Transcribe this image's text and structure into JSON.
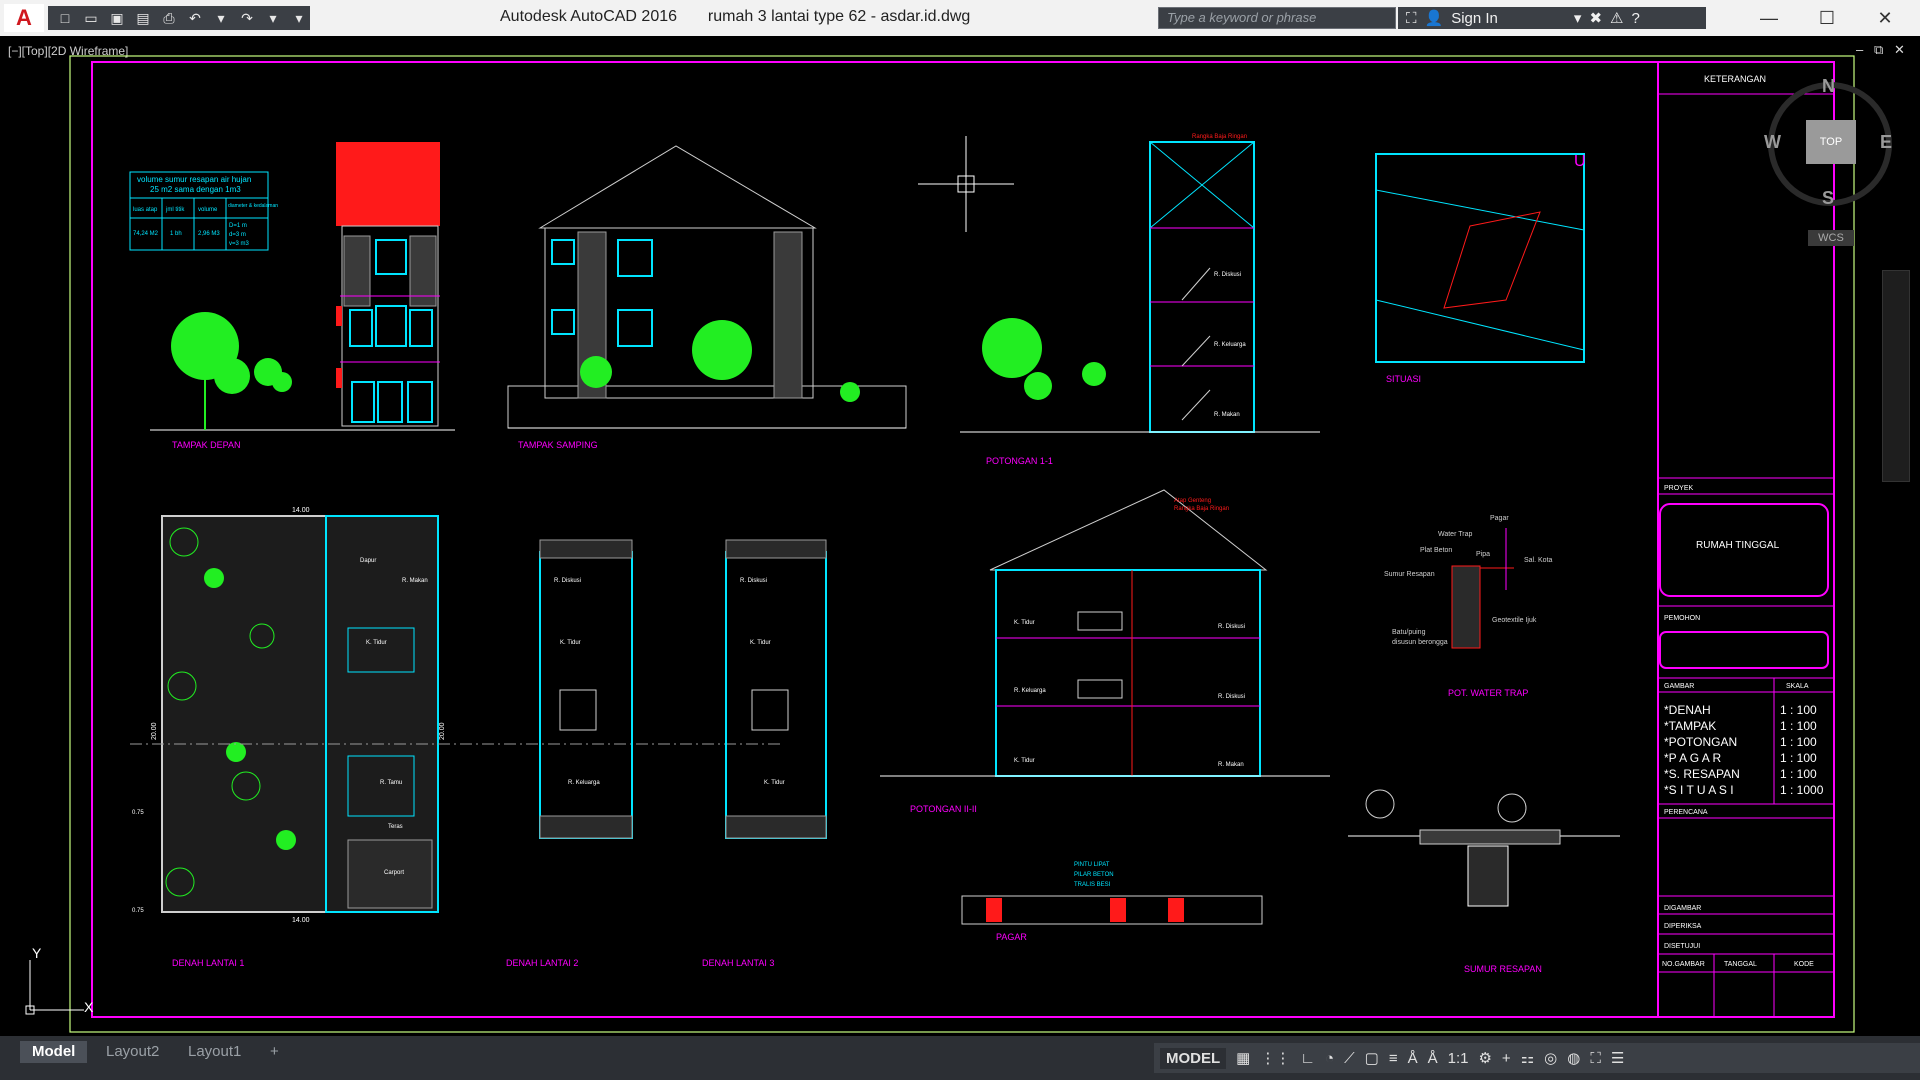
{
  "app": {
    "title": "Autodesk AutoCAD 2016",
    "file": "rumah 3 lantai type 62 - asdar.id.dwg"
  },
  "search": {
    "placeholder": "Type a keyword or phrase"
  },
  "user": {
    "sign_in": "Sign In"
  },
  "viewport": {
    "label": "[−][Top][2D Wireframe]"
  },
  "navcube": {
    "n": "N",
    "s": "S",
    "e": "E",
    "w": "W",
    "top": "TOP",
    "wcs": "WCS"
  },
  "ucs": {
    "y": "Y",
    "x": "X"
  },
  "drawing": {
    "titles": {
      "tampak_depan": "TAMPAK DEPAN",
      "tampak_samping": "TAMPAK SAMPING",
      "potongan_1": "POTONGAN 1-1",
      "situasi": "SITUASI",
      "denah1": "DENAH LANTAI 1",
      "denah2": "DENAH LANTAI 2",
      "denah3": "DENAH LANTAI 3",
      "potongan_2": "POTONGAN II-II",
      "pagar": "PAGAR",
      "water_trap": "POT. WATER TRAP",
      "sumur": "SUMUR RESAPAN"
    },
    "table": {
      "title1": "volume sumur resapan air hujan",
      "title2": "25 m2 sama dengan 1m3",
      "h1": "luas atap",
      "h2": "jml titik",
      "h3": "volume",
      "h4": "diameter & kedalaman",
      "v1": "74,24 M2",
      "v2": "1 bh",
      "v3": "2,96 M3",
      "v4a": "D=1 m",
      "v4b": "d=3 m",
      "v4c": "v=3 m3"
    },
    "rooms": {
      "dapur": "Dapur",
      "r_makan": "R. Makan",
      "k_tidur": "K. Tidur",
      "r_tamu": "R. Tamu",
      "teras": "Teras",
      "carport": "Carport",
      "r_diskusi": "R. Diskusi",
      "r_keluarga": "R. Keluarga"
    },
    "dims": {
      "w": "14.00",
      "h": "20.00",
      "d1": "0.75",
      "d2": "0.75"
    },
    "pot_labels": {
      "atap": "Rangka Baja Ringan",
      "genteng": "Atap Genteng",
      "k_tidur": "K. Tidur",
      "r_diskusi": "R. Diskusi",
      "r_keluarga": "R. Keluarga",
      "r_makan": "R. Makan"
    },
    "water": {
      "pagar": "Pagar",
      "water_trap": "Water Trap",
      "plat_beton": "Plat Beton",
      "pipa": "Pipa",
      "sal_kota": "Sal. Kota",
      "sumur": "Sumur Resapan",
      "geo": "Geotextile Ijuk",
      "batu": "Batu/puing",
      "batu2": "disusun berongga"
    },
    "pagar_notes": {
      "l1": "PINTU LIPAT",
      "l2": "PILAR BETON",
      "l3": "TRALIS BESI"
    },
    "north": "U"
  },
  "titleblock": {
    "keterangan": "KETERANGAN",
    "proyek": "PROYEK",
    "project_name": "RUMAH TINGGAL",
    "pemohon": "PEMOHON",
    "gambar": "GAMBAR",
    "skala": "SKALA",
    "items": [
      {
        "name": "*DENAH",
        "scale": "1 : 100"
      },
      {
        "name": "*TAMPAK",
        "scale": "1 : 100"
      },
      {
        "name": "*POTONGAN",
        "scale": "1 : 100"
      },
      {
        "name": "*P A G A R",
        "scale": "1 : 100"
      },
      {
        "name": "*S. RESAPAN",
        "scale": "1 : 100"
      },
      {
        "name": "*S I T U A S I",
        "scale": "1 : 1000"
      }
    ],
    "perencana": "PERENCANA",
    "digambar": "DIGAMBAR",
    "diperiksa": "DIPERIKSA",
    "disetujui": "DISETUJUI",
    "no_gambar": "NO.GAMBAR",
    "tanggal": "TANGGAL",
    "kode": "KODE"
  },
  "tabs": {
    "model": "Model",
    "layout2": "Layout2",
    "layout1": "Layout1"
  },
  "status": {
    "model": "MODEL",
    "scale": "1:1"
  },
  "colors": {
    "magenta": "#ff00ff",
    "cyan": "#00e5ff",
    "red": "#ff1a1a",
    "green": "#22ee22",
    "white": "#ffffff",
    "grey": "#9a9a9a"
  }
}
